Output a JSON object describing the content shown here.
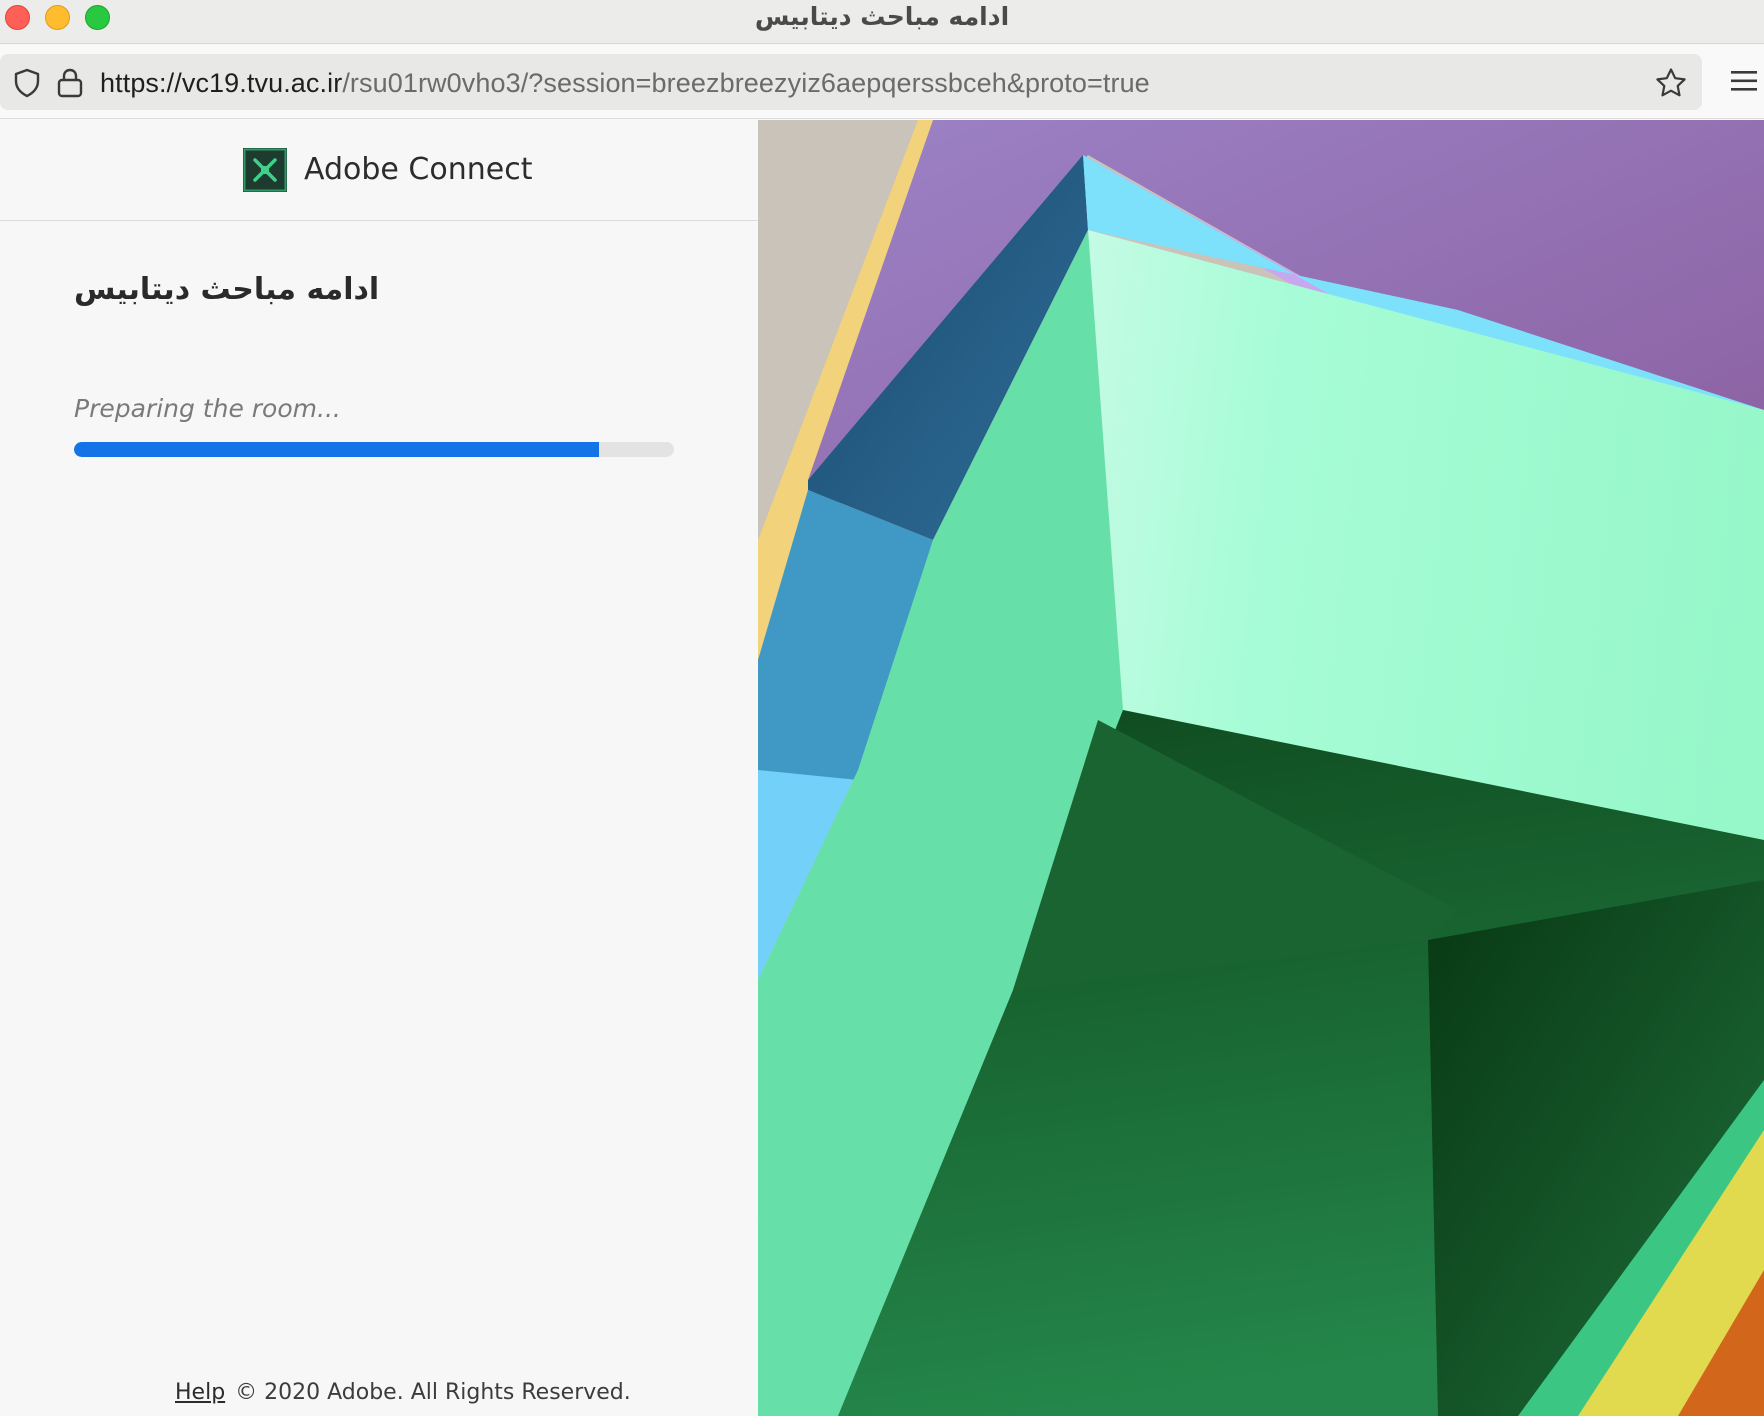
{
  "window": {
    "title": "ادامه مباحث دیتابیس"
  },
  "browser": {
    "url_host": "https://vc19.tvu.ac.ir",
    "url_path": "/rsu01rw0vho3/?session=breezbreezyiz6aepqerssbceh&proto=true",
    "icons": {
      "shield": "shield-icon",
      "lock": "lock-icon",
      "bookmark": "star-icon",
      "menu": "hamburger-menu-icon"
    }
  },
  "brand": {
    "name": "Adobe Connect",
    "logo_icon": "adobe-connect-logo",
    "logo_color": "#2d9a68"
  },
  "meeting": {
    "title": "ادامه مباحث دیتابیس",
    "status": "Preparing the room...",
    "progress_percent": 87.5,
    "progress_color": "#1473e6"
  },
  "footer": {
    "help_label": "Help",
    "copyright": "© 2020 Adobe. All Rights Reserved."
  }
}
